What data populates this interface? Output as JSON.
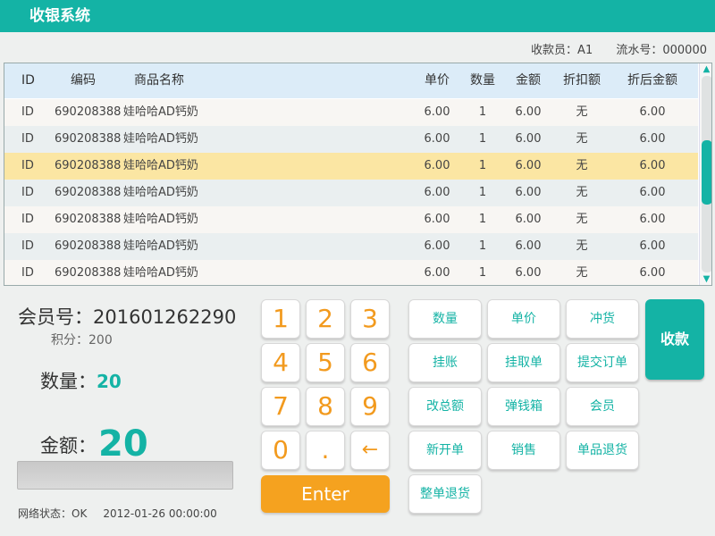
{
  "app": {
    "title": "收银系统"
  },
  "info": {
    "cashier": "收款员：A1",
    "serial": "流水号：000000"
  },
  "table": {
    "headers": {
      "id": "ID",
      "code": "编码",
      "name": "商品名称",
      "price": "单价",
      "qty": "数量",
      "amount": "金额",
      "discount": "折扣额",
      "final": "折后金额"
    },
    "rows": [
      {
        "id": "ID",
        "code": "690208388",
        "name": "娃哈哈AD钙奶",
        "price": "6.00",
        "qty": "1",
        "amount": "6.00",
        "discount": "无",
        "final": "6.00"
      },
      {
        "id": "ID",
        "code": "690208388",
        "name": "娃哈哈AD钙奶",
        "price": "6.00",
        "qty": "1",
        "amount": "6.00",
        "discount": "无",
        "final": "6.00"
      },
      {
        "id": "ID",
        "code": "690208388",
        "name": "娃哈哈AD钙奶",
        "price": "6.00",
        "qty": "1",
        "amount": "6.00",
        "discount": "无",
        "final": "6.00"
      },
      {
        "id": "ID",
        "code": "690208388",
        "name": "娃哈哈AD钙奶",
        "price": "6.00",
        "qty": "1",
        "amount": "6.00",
        "discount": "无",
        "final": "6.00"
      },
      {
        "id": "ID",
        "code": "690208388",
        "name": "娃哈哈AD钙奶",
        "price": "6.00",
        "qty": "1",
        "amount": "6.00",
        "discount": "无",
        "final": "6.00"
      },
      {
        "id": "ID",
        "code": "690208388",
        "name": "娃哈哈AD钙奶",
        "price": "6.00",
        "qty": "1",
        "amount": "6.00",
        "discount": "无",
        "final": "6.00"
      },
      {
        "id": "ID",
        "code": "690208388",
        "name": "娃哈哈AD钙奶",
        "price": "6.00",
        "qty": "1",
        "amount": "6.00",
        "discount": "无",
        "final": "6.00"
      }
    ],
    "selected_row_index": 2
  },
  "summary": {
    "member_label": "会员号：",
    "member_no": "201601262290",
    "points_label": "积分：",
    "points": "200",
    "qty_label": "数量：",
    "qty": "20",
    "amount_label": "金额：",
    "amount": "20"
  },
  "status": {
    "network": "网络状态：OK",
    "datetime": "2012-01-26 00:00:00"
  },
  "keypad": {
    "k1": "1",
    "k2": "2",
    "k3": "3",
    "k4": "4",
    "k5": "5",
    "k6": "6",
    "k7": "7",
    "k8": "8",
    "k9": "9",
    "k0": "0",
    "dot": ".",
    "back": "←",
    "enter": "Enter"
  },
  "functions": {
    "qty": "数量",
    "price": "单价",
    "reverse": "冲货",
    "hang": "挂账",
    "retrieve": "挂取单",
    "submit": "提交订单",
    "change_total": "改总额",
    "cash_drawer": "弹钱箱",
    "member": "会员",
    "new_order": "新开单",
    "sale": "销售",
    "return_item": "单品退货",
    "return_order": "整单退货",
    "pay": "收款"
  },
  "colors": {
    "accent": "#14b3a5",
    "keypad_digit": "#f29a1e",
    "enter_button": "#f5a21f",
    "selected_row": "#fbe6a3",
    "table_header": "#dcecf8"
  },
  "icons": {
    "scroll_up": "chevron-up-icon",
    "scroll_down": "chevron-down-icon",
    "backspace": "arrow-left-icon"
  }
}
